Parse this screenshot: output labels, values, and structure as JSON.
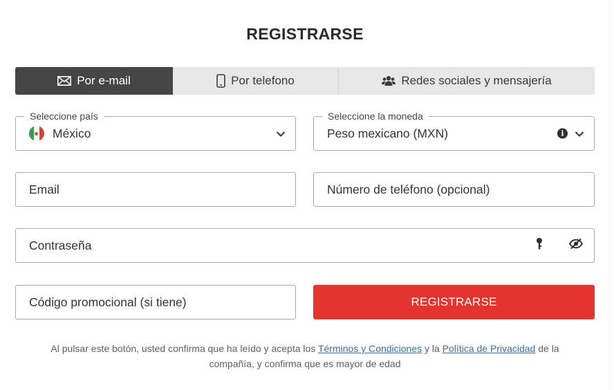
{
  "page_title": "REGISTRARSE",
  "tabs": [
    {
      "label": "Por e-mail",
      "icon": "envelope-icon",
      "active": true
    },
    {
      "label": "Por telefono",
      "icon": "phone-icon",
      "active": false
    },
    {
      "label": "Redes sociales y mensajería",
      "icon": "users-icon",
      "active": false
    }
  ],
  "country": {
    "legend": "Seleccione país",
    "value": "México",
    "flag": "mexico-flag"
  },
  "currency": {
    "legend": "Seleccione la moneda",
    "value": "Peso mexicano (MXN)"
  },
  "email": {
    "placeholder": "Email"
  },
  "phone": {
    "placeholder": "Número de teléfono (opcional)"
  },
  "password": {
    "placeholder": "Contraseña"
  },
  "promo": {
    "placeholder": "Código promocional (si tiene)"
  },
  "register_button": "REGISTRARSE",
  "legal": {
    "text_1": "Al pulsar este botón, usted confirma que ha leído y acepta los ",
    "terms_link": "Términos y Condiciones",
    "text_2": " y la ",
    "privacy_link": "Política de Privacidad",
    "text_3": " de la compañía, y confirma que es mayor de edad"
  },
  "colors": {
    "accent": "#e5332e",
    "tab_active": "#454545",
    "tab_inactive": "#e7e7e7",
    "link": "#3d6da0"
  }
}
